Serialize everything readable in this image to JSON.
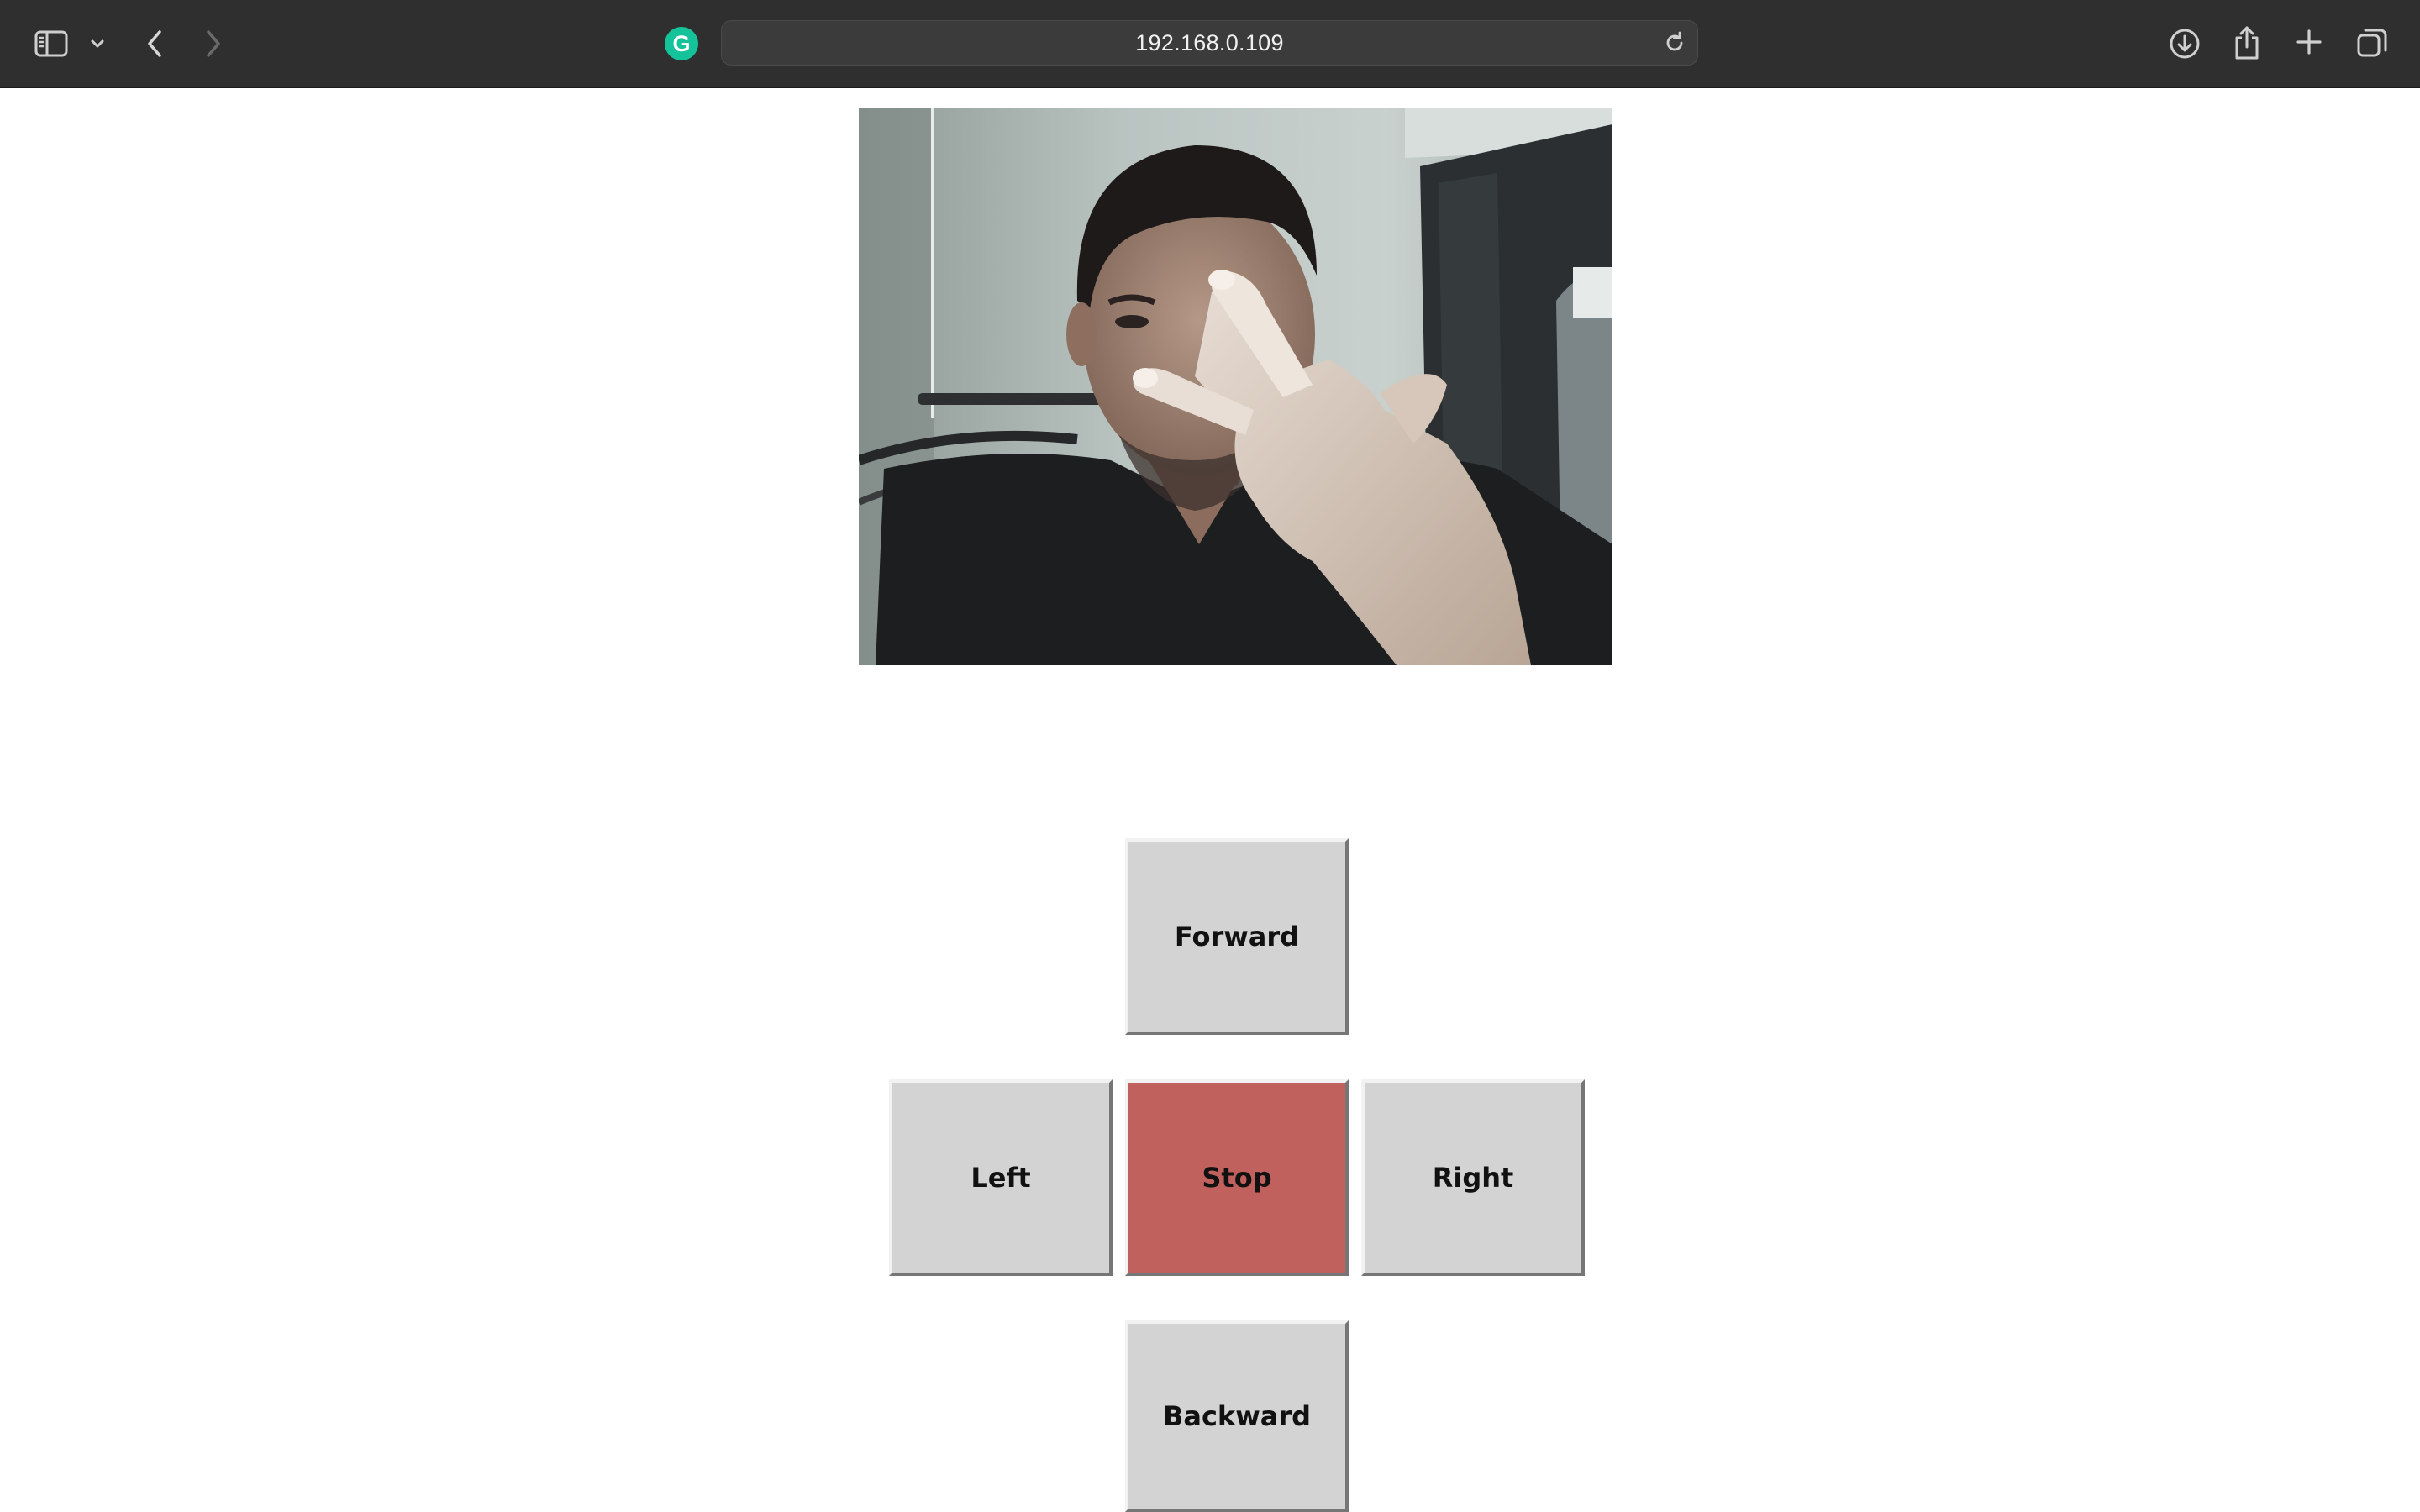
{
  "browser": {
    "url": "192.168.0.109",
    "icons": {
      "sidebar": "sidebar-icon",
      "sidebar_menu": "chevron-down-icon",
      "back": "chevron-left-icon",
      "forward": "chevron-right-icon",
      "extension": "grammarly-icon",
      "reload": "reload-icon",
      "downloads": "download-icon",
      "share": "share-icon",
      "new_tab": "plus-icon",
      "tab_overview": "tabs-icon"
    },
    "extension_letter": "G"
  },
  "camera": {
    "description_icon": "camera-feed-image"
  },
  "controls": {
    "forward": "Forward",
    "left": "Left",
    "stop": "Stop",
    "right": "Right",
    "backward": "Backward",
    "stop_color": "#c0615e",
    "button_color": "#d3d3d3"
  }
}
